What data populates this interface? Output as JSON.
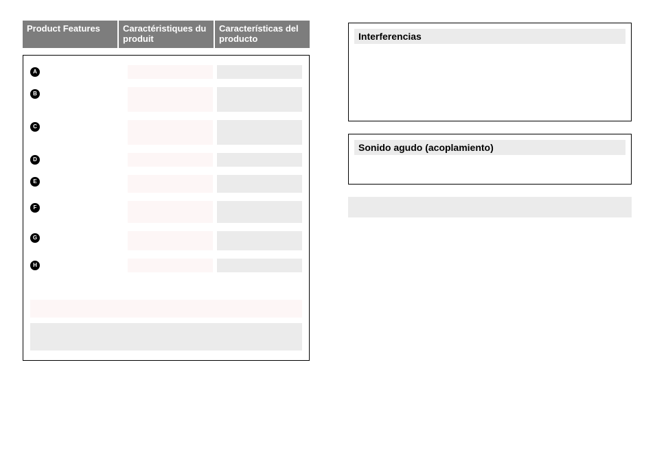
{
  "tabs": {
    "en": "Product Features",
    "fr": "Caractéristiques du produit",
    "es": "Características del producto"
  },
  "features": [
    {
      "letter": "A",
      "en": "",
      "fr": "",
      "es": ""
    },
    {
      "letter": "B",
      "en": "",
      "fr": "",
      "es": ""
    },
    {
      "letter": "C",
      "en": "",
      "fr": "",
      "es": ""
    },
    {
      "letter": "D",
      "en": "",
      "fr": "",
      "es": ""
    },
    {
      "letter": "E",
      "en": "",
      "fr": "",
      "es": ""
    },
    {
      "letter": "F",
      "en": "",
      "fr": "",
      "es": ""
    },
    {
      "letter": "G",
      "en": "",
      "fr": "",
      "es": ""
    },
    {
      "letter": "H",
      "en": "",
      "fr": "",
      "es": ""
    }
  ],
  "note_fr": "",
  "note_es": "",
  "right": {
    "section1": {
      "title": "Interferencias",
      "body": ""
    },
    "section2": {
      "title": "Sonido agudo (acoplamiento)",
      "body": ""
    },
    "para": ""
  }
}
